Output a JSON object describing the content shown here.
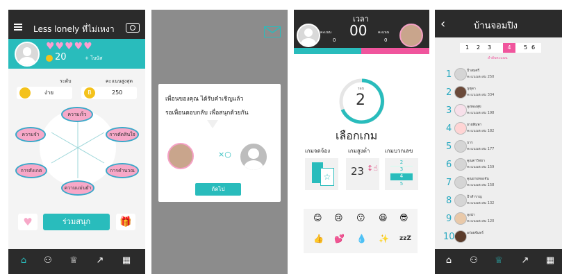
{
  "screen1": {
    "title": "Less lonely ที่ไม่เหงา",
    "hearts": "♥♥♥♥♥",
    "coins": "20",
    "bonus": "+ โบนัส",
    "level_label": "ระดับ",
    "level_value": "ง่าย",
    "best_label": "คะแนนสูงสุด",
    "best_value": "250",
    "b_icon": "B",
    "skills": [
      "ความเร็ว",
      "ความจำ",
      "การตัดสินใจ",
      "การคำนวณ",
      "การสังเกต",
      "ความแม่นยำ"
    ],
    "join_button": "ร่วมสนุก",
    "nav_icons": [
      "home-icon",
      "friends-icon",
      "trophy-icon",
      "chart-icon",
      "grid-icon"
    ],
    "accent": "#29bcbc",
    "pink": "#f7a8c8"
  },
  "screen2": {
    "message_line1": "เพื่อนของคุณ ได้รับคำเชิญแล้ว",
    "message_line2": "รอเพื่อนตอบกลับ เพื่อสนุกด้วยกัน",
    "next_button": "ถัดไป"
  },
  "screen3": {
    "time_label": "เวลา",
    "timer": "00",
    "score_label": "คะแนน",
    "score_left": "0",
    "score_right": "0",
    "round_label": "รอบ",
    "round": "2",
    "choose_game": "เลือกเกม",
    "games": [
      "เกมจดจ้อง",
      "เกมสูงต่ำ",
      "เกมบวกเลข"
    ],
    "hl_number": "23",
    "num_list": [
      "2",
      "3",
      "4",
      "5"
    ],
    "emojis": [
      "😊",
      "😢",
      "😗",
      "😆",
      "😎",
      "👍",
      "💕",
      "💧",
      "✨",
      "zzZ"
    ]
  },
  "screen4": {
    "title": "บ้านจอมปิง",
    "pages": [
      "1",
      "2",
      "3",
      "4",
      "5",
      "6"
    ],
    "active_page": "4",
    "subtitle": "ลำดับคะแนน",
    "rows": [
      {
        "rank": "1",
        "name": "ป้าสมศรี",
        "score": "คะแนนสะสม 250"
      },
      {
        "rank": "2",
        "name": "นุชุดา",
        "score": "คะแนนสะสม 334"
      },
      {
        "rank": "3",
        "name": "ลุงทองสุข",
        "score": "คะแนนสะสม 198"
      },
      {
        "rank": "4",
        "name": "ยายพิมพา",
        "score": "คะแนนสะสม 182"
      },
      {
        "rank": "5",
        "name": "บาร",
        "score": "คะแนนสะสม 177"
      },
      {
        "rank": "6",
        "name": "คุณตาวิทยา",
        "score": "คะแนนสะสม 159"
      },
      {
        "rank": "7",
        "name": "คุณยายทองจัน",
        "score": "คะแนนสะสม 158"
      },
      {
        "rank": "8",
        "name": "ป้าสำราญ",
        "score": "คะแนนสะสม 132"
      },
      {
        "rank": "9",
        "name": "ลุงน่า",
        "score": "คะแนนสะสม 120"
      },
      {
        "rank": "10",
        "name": "อร่อยจันทร์",
        "score": ""
      }
    ]
  }
}
